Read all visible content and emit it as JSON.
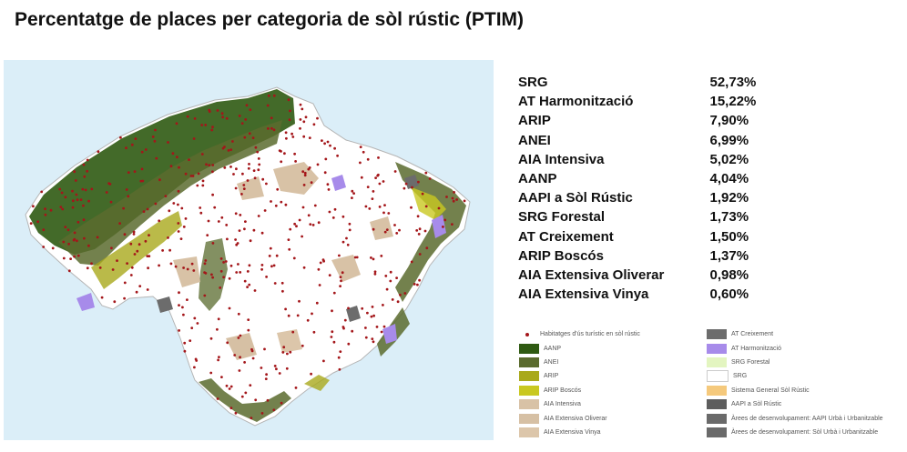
{
  "title": "Percentatge de places per categoria de sòl rústic (PTIM)",
  "stats": [
    {
      "label": "SRG",
      "value": "52,73%"
    },
    {
      "label": "AT Harmonització",
      "value": "15,22%"
    },
    {
      "label": "ARIP",
      "value": "7,90%"
    },
    {
      "label": "ANEI",
      "value": "6,99%"
    },
    {
      "label": "AIA Intensiva",
      "value": "5,02%"
    },
    {
      "label": "AANP",
      "value": "4,04%"
    },
    {
      "label": "AAPI a Sòl Rústic",
      "value": "1,92%"
    },
    {
      "label": "SRG Forestal",
      "value": "1,73%"
    },
    {
      "label": "AT Creixement",
      "value": "1,50%"
    },
    {
      "label": "ARIP Boscós",
      "value": "1,37%"
    },
    {
      "label": "AIA Extensiva Oliverar",
      "value": "0,98%"
    },
    {
      "label": "AIA Extensiva Vinya",
      "value": "0,60%"
    }
  ],
  "legend_left": [
    {
      "label": "Habitatges d'ús turístic en sòl rústic",
      "color": "#a4161a",
      "kind": "dot"
    },
    {
      "label": "AANP",
      "color": "#2f5a12",
      "kind": "swatch"
    },
    {
      "label": "ANEI",
      "color": "#5a6b2e",
      "kind": "swatch"
    },
    {
      "label": "ARIP",
      "color": "#a9a91c",
      "kind": "swatch"
    },
    {
      "label": "ARIP Boscós",
      "color": "#c9c820",
      "kind": "swatch"
    },
    {
      "label": "AIA Intensiva",
      "color": "#d8c2a6",
      "kind": "swatch"
    },
    {
      "label": "AIA Extensiva Oliverar",
      "color": "#d6c0a4",
      "kind": "swatch"
    },
    {
      "label": "AIA Extensiva Vinya",
      "color": "#dcc6aa",
      "kind": "swatch"
    }
  ],
  "legend_right": [
    {
      "label": "AT Creixement",
      "color": "#6c6c6c",
      "kind": "swatch"
    },
    {
      "label": "AT Harmonització",
      "color": "#a78bea",
      "kind": "swatch"
    },
    {
      "label": "SRG Forestal",
      "color": "#e3f5c0",
      "kind": "swatch"
    },
    {
      "label": "SRG",
      "color": "#ffffff",
      "kind": "swatch"
    },
    {
      "label": "Sistema General Sòl Rústic",
      "color": "#f5c97c",
      "kind": "swatch"
    },
    {
      "label": "AAPI a Sòl Rústic",
      "color": "#5d5d5d",
      "kind": "swatch"
    },
    {
      "label": "Àrees de desenvolupament: AAPI Urbà i Urbanitzable",
      "color": "#6a6a6a",
      "kind": "swatch"
    },
    {
      "label": "Àrees de desenvolupament: Sòl Urbà i Urbanitzable",
      "color": "#6a6a6a",
      "kind": "swatch"
    }
  ]
}
